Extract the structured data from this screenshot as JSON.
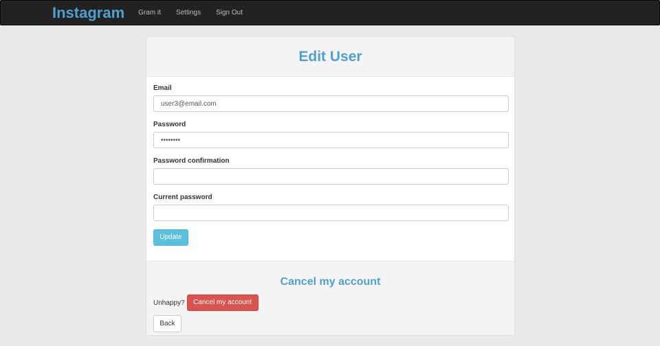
{
  "navbar": {
    "brand": "Instagram",
    "links": [
      "Gram it",
      "Settings",
      "Sign Out"
    ]
  },
  "panel": {
    "title": "Edit User"
  },
  "form": {
    "email_label": "Email",
    "email_value": "user3@email.com",
    "password_label": "Password",
    "password_value": "••••••••",
    "password_confirmation_label": "Password confirmation",
    "password_confirmation_value": "",
    "current_password_label": "Current password",
    "current_password_value": "",
    "update_label": "Update"
  },
  "cancel": {
    "title": "Cancel my account",
    "prompt": "Unhappy?",
    "button_label": "Cancel my account"
  },
  "back_label": "Back",
  "colors": {
    "brand": "#4ea0d0",
    "navbar_bg": "#222222",
    "update_button": "#5bc0de",
    "danger_button": "#d9534f"
  }
}
